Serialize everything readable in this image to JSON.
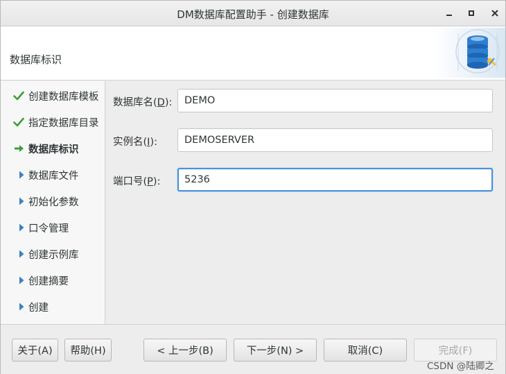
{
  "window": {
    "title": "DM数据库配置助手 - 创建数据库",
    "controls": [
      "minimize-icon",
      "maximize-icon",
      "close-icon"
    ]
  },
  "header": {
    "title": "数据库标识",
    "graphic": "database-config-icon"
  },
  "sidebar": {
    "items": [
      {
        "label": "创建数据库模板",
        "status": "done",
        "icon": "check-icon"
      },
      {
        "label": "指定数据库目录",
        "status": "done",
        "icon": "check-icon"
      },
      {
        "label": "数据库标识",
        "status": "current",
        "icon": "arrow-right-icon"
      },
      {
        "label": "数据库文件",
        "status": "pending",
        "icon": "triangle-right-icon"
      },
      {
        "label": "初始化参数",
        "status": "pending",
        "icon": "triangle-right-icon"
      },
      {
        "label": "口令管理",
        "status": "pending",
        "icon": "triangle-right-icon"
      },
      {
        "label": "创建示例库",
        "status": "pending",
        "icon": "triangle-right-icon"
      },
      {
        "label": "创建摘要",
        "status": "pending",
        "icon": "triangle-right-icon"
      },
      {
        "label": "创建",
        "status": "pending",
        "icon": "triangle-right-icon"
      }
    ]
  },
  "form": {
    "db_name": {
      "label_pre": "数据库名(",
      "mnemonic": "D",
      "label_post": "):",
      "value": "DEMO"
    },
    "instance_name": {
      "label_pre": "实例名(",
      "mnemonic": "I",
      "label_post": "):",
      "value": "DEMOSERVER"
    },
    "port": {
      "label_pre": "端口号(",
      "mnemonic": "P",
      "label_post": "):",
      "value": "5236"
    }
  },
  "footer": {
    "about": "关于(A)",
    "help": "帮助(H)",
    "back": "< 上一步(B)",
    "next": "下一步(N) >",
    "cancel": "取消(C)",
    "finish": "完成(F)",
    "watermark": "CSDN @陆卿之"
  },
  "colors": {
    "check": "#3a9e3a",
    "arrow": "#3a9e3a",
    "triangle": "#3b7fc4",
    "focus": "#4a90d9"
  }
}
